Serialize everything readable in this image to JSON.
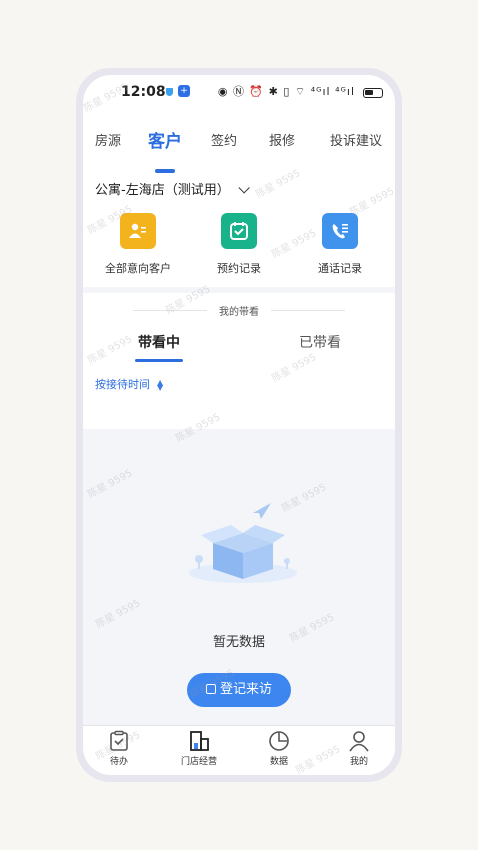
{
  "status_bar": {
    "time": "12:08",
    "icons_text": "◉ Ⓝ ⏰ ✱ ▯ ⌔ ⁴ᴳıl ⁴ᴳıl",
    "app_badge": "+"
  },
  "top_tabs": [
    {
      "label": "房源",
      "active": false
    },
    {
      "label": "客户",
      "active": true
    },
    {
      "label": "签约",
      "active": false
    },
    {
      "label": "报修",
      "active": false
    },
    {
      "label": "投诉建议",
      "active": false
    }
  ],
  "store_selector": {
    "label": "公寓-左海店（测试用）"
  },
  "quick_actions": [
    {
      "label": "全部意向客户",
      "icon": "customer-card-icon",
      "color": "#f3b31d"
    },
    {
      "label": "预约记录",
      "icon": "calendar-check-icon",
      "color": "#18b38a"
    },
    {
      "label": "通话记录",
      "icon": "phone-list-icon",
      "color": "#3f93ec"
    }
  ],
  "viewings": {
    "title": "我的带看",
    "tabs": [
      {
        "label": "带看中",
        "active": true
      },
      {
        "label": "已带看",
        "active": false
      }
    ],
    "sort_label": "按接待时间"
  },
  "empty_state": {
    "text": "暂无数据",
    "button_label": "登记来访"
  },
  "bottom_nav": [
    {
      "label": "待办",
      "icon": "todo-clipboard-icon"
    },
    {
      "label": "门店经营",
      "icon": "store-building-icon"
    },
    {
      "label": "数据",
      "icon": "pie-chart-icon"
    },
    {
      "label": "我的",
      "icon": "profile-icon"
    }
  ],
  "watermark": "陈星 9595",
  "colors": {
    "accent": "#2c6ee0",
    "button": "#3d86ef",
    "background": "#f4f5f9"
  }
}
